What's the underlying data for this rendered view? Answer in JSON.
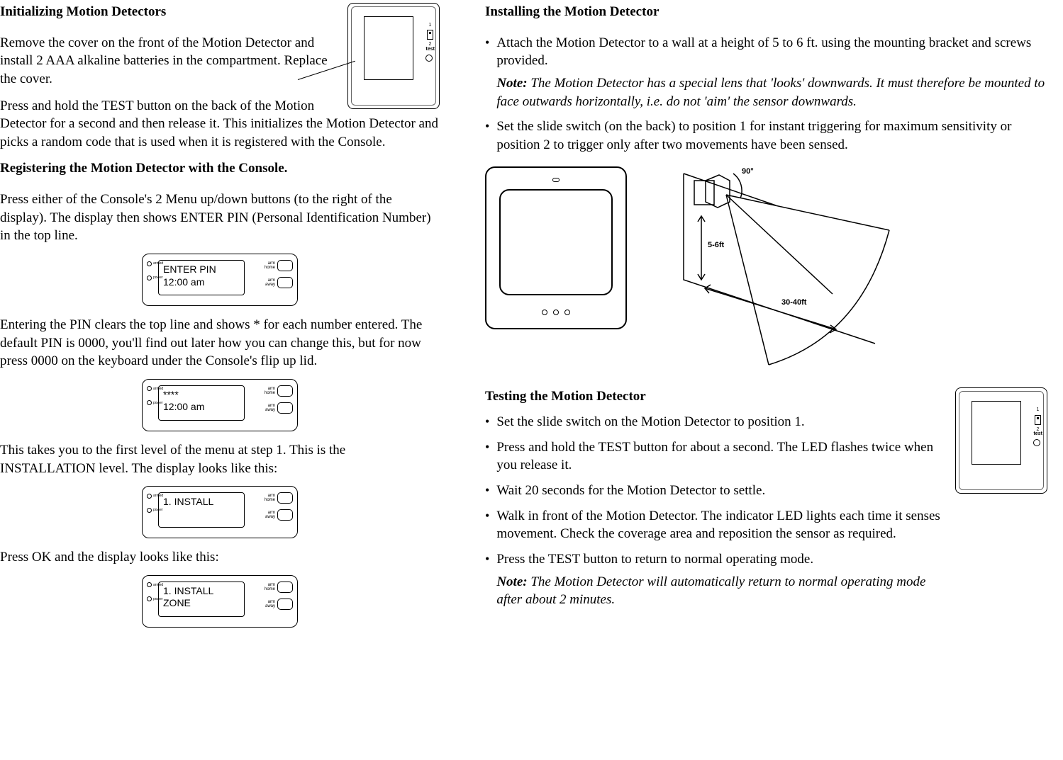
{
  "left": {
    "h1": "Initializing Motion Detectors",
    "p1": "Remove the cover on the front of the Motion Detector and install 2 AAA alkaline batteries in the compartment. Replace the cover.",
    "p2": "Press and hold  the TEST button on the back of the Motion Detector for a second and then release it. This initializes the Motion Detector and picks a random code that is used when it is registered with the Console.",
    "h2": "Registering the Motion Detector with the Console.",
    "p3": "Press either of the Console's 2 Menu up/down buttons (to the right of the display). The display then shows ENTER PIN (Personal Identification Number) in the top line.",
    "p4": "Entering the PIN clears the top line and shows * for each number entered. The default PIN is 0000, you'll find out later how you can change this, but for now press 0000 on the keyboard under the Console's flip up lid.",
    "p5": "This takes you to the first level of the menu at step 1. This is the INSTALLATION level. The display looks like this:",
    "p6": "Press OK and the display looks like this:"
  },
  "right": {
    "h1": "Installing the Motion Detector",
    "b1": "Attach the Motion Detector to a wall at a height of 5 to 6 ft. using the mounting bracket and screws provided.",
    "b1note": "The Motion Detector has a special lens that 'looks' downwards. It must therefore be mounted to face outwards horizontally, i.e. do not 'aim' the sensor downwards.",
    "b2": "Set the slide switch (on the back) to position 1 for instant triggering for maximum sensitivity or position 2 to trigger only after two movements have been sensed.",
    "h2": "Testing the Motion Detector",
    "t1": "Set the slide switch on the Motion Detector to position 1.",
    "t2": "Press and hold the TEST button for about a second. The LED flashes twice when you release it.",
    "t3": "Wait 20 seconds for the Motion Detector to settle.",
    "t4": "Walk in front of the Motion Detector. The indicator LED lights each time it senses movement. Check the coverage area and reposition the sensor as required.",
    "t5": "Press the TEST button to return to normal operating mode.",
    "t5note": "The Motion Detector will automatically return to normal operating mode after about 2 minutes."
  },
  "console": {
    "led1": "armed",
    "led2": "power",
    "btn1a": "arm",
    "btn1b": "home",
    "btn2a": "arm",
    "btn2b": "away",
    "screens": [
      {
        "line1": "ENTER PIN",
        "line2": "12:00 am"
      },
      {
        "line1": "****",
        "line2": "12:00 am"
      },
      {
        "line1": "1. INSTALL",
        "line2": ""
      },
      {
        "line1": "1. INSTALL",
        "line2": "ZONE"
      }
    ]
  },
  "detector_back": {
    "pos1": "1",
    "pos2": "2",
    "test": "test"
  },
  "coverage": {
    "angle": "90°",
    "height": "5-6ft",
    "range": "30-40ft"
  },
  "note_label": "Note:"
}
